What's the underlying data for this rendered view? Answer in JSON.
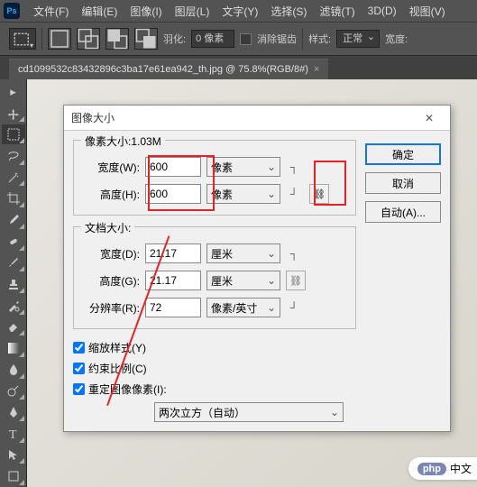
{
  "menu": {
    "items": [
      "文件(F)",
      "编辑(E)",
      "图像(I)",
      "图层(L)",
      "文字(Y)",
      "选择(S)",
      "滤镜(T)",
      "3D(D)",
      "视图(V)"
    ]
  },
  "options": {
    "feather_label": "羽化:",
    "feather_value": "0 像素",
    "antialias_label": "消除锯齿",
    "style_label": "样式:",
    "style_value": "正常",
    "width_label": "宽度:"
  },
  "tab": {
    "title": "cd1099532c83432896c3ba17e61ea942_th.jpg @ 75.8%(RGB/8#)",
    "close": "×"
  },
  "dialog": {
    "title": "图像大小",
    "close": "✕",
    "pixel_legend": "像素大小:1.03M",
    "width_label": "宽度(W):",
    "height_label": "高度(H):",
    "px_width": "600",
    "px_height": "600",
    "unit_px": "像素",
    "doc_legend": "文档大小:",
    "doc_width_label": "宽度(D):",
    "doc_height_label": "高度(G):",
    "doc_width": "21.17",
    "doc_height": "21.17",
    "unit_cm": "厘米",
    "res_label": "分辨率(R):",
    "res_value": "72",
    "unit_res": "像素/英寸",
    "scale_styles": "缩放样式(Y)",
    "constrain": "约束比例(C)",
    "resample": "重定图像像素(I):",
    "interp": "两次立方（自动）",
    "ok": "确定",
    "cancel": "取消",
    "auto": "自动(A)...",
    "link": "⛓"
  },
  "watermark": {
    "badge": "php",
    "text": "中文"
  }
}
